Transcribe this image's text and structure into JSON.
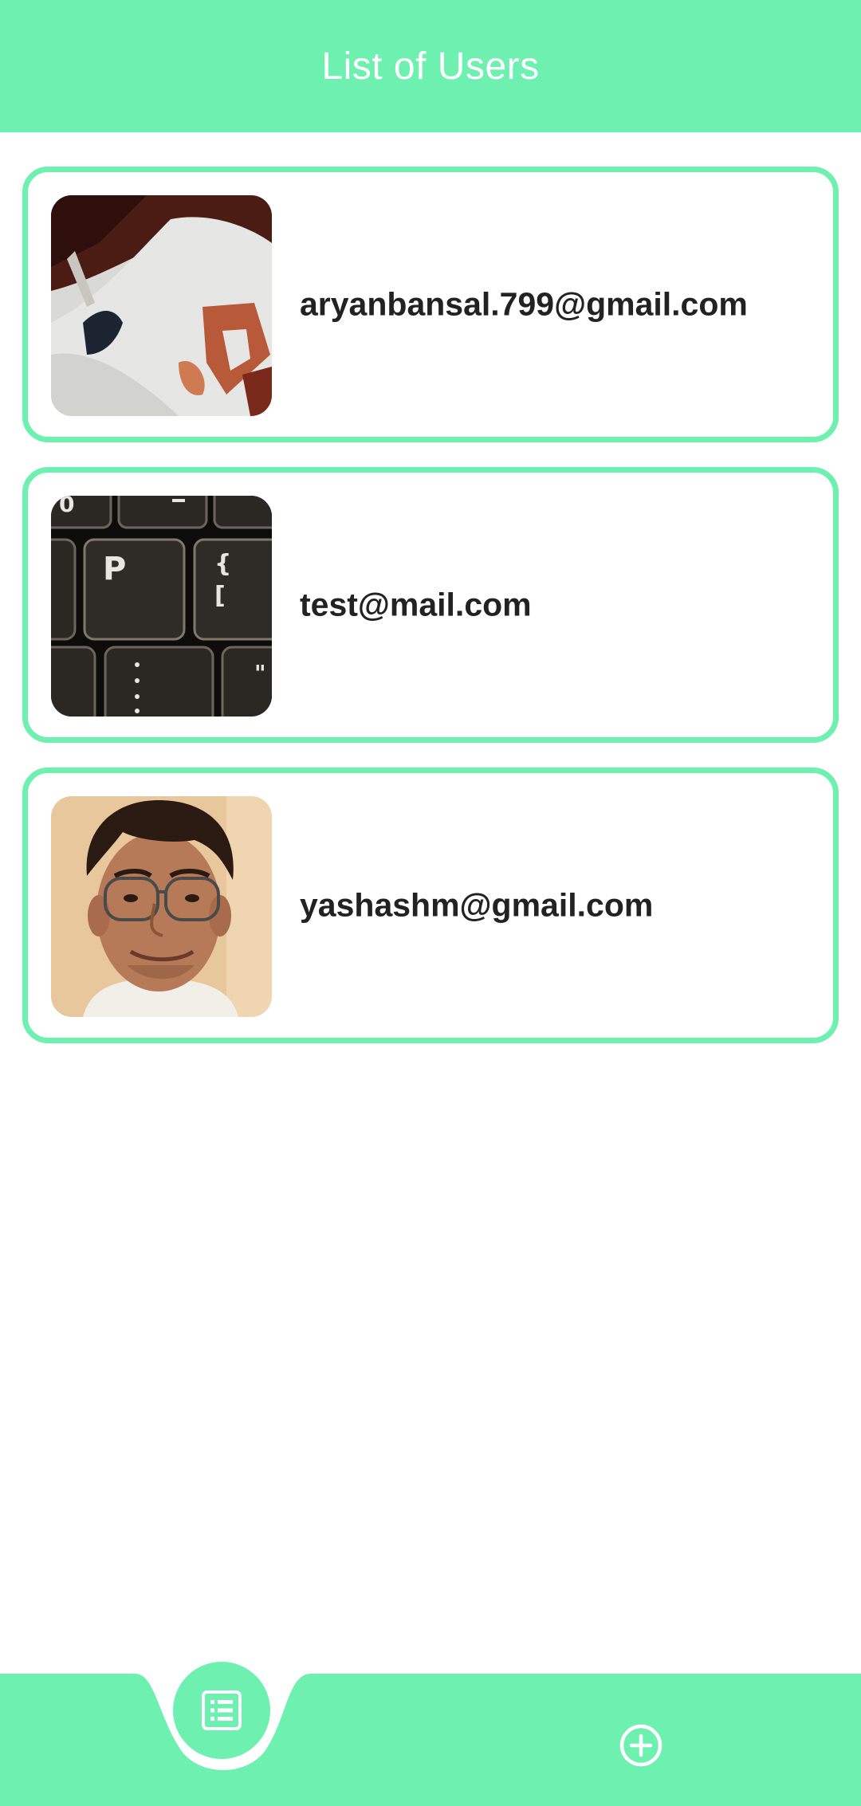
{
  "app_bar": {
    "title": "List of Users",
    "background": "#6ef0b0"
  },
  "users": [
    {
      "email": "aryanbansal.799@gmail.com",
      "avatar": "photo-fabric"
    },
    {
      "email": "test@mail.com",
      "avatar": "photo-keyboard"
    },
    {
      "email": "yashashm@gmail.com",
      "avatar": "photo-person"
    }
  ],
  "bottom_nav": {
    "items": [
      {
        "icon": "list-icon",
        "active": true
      },
      {
        "icon": "add-circle-icon",
        "active": false
      }
    ]
  },
  "colors": {
    "accent": "#6ef0b0",
    "text": "#222222",
    "background": "#ffffff"
  }
}
